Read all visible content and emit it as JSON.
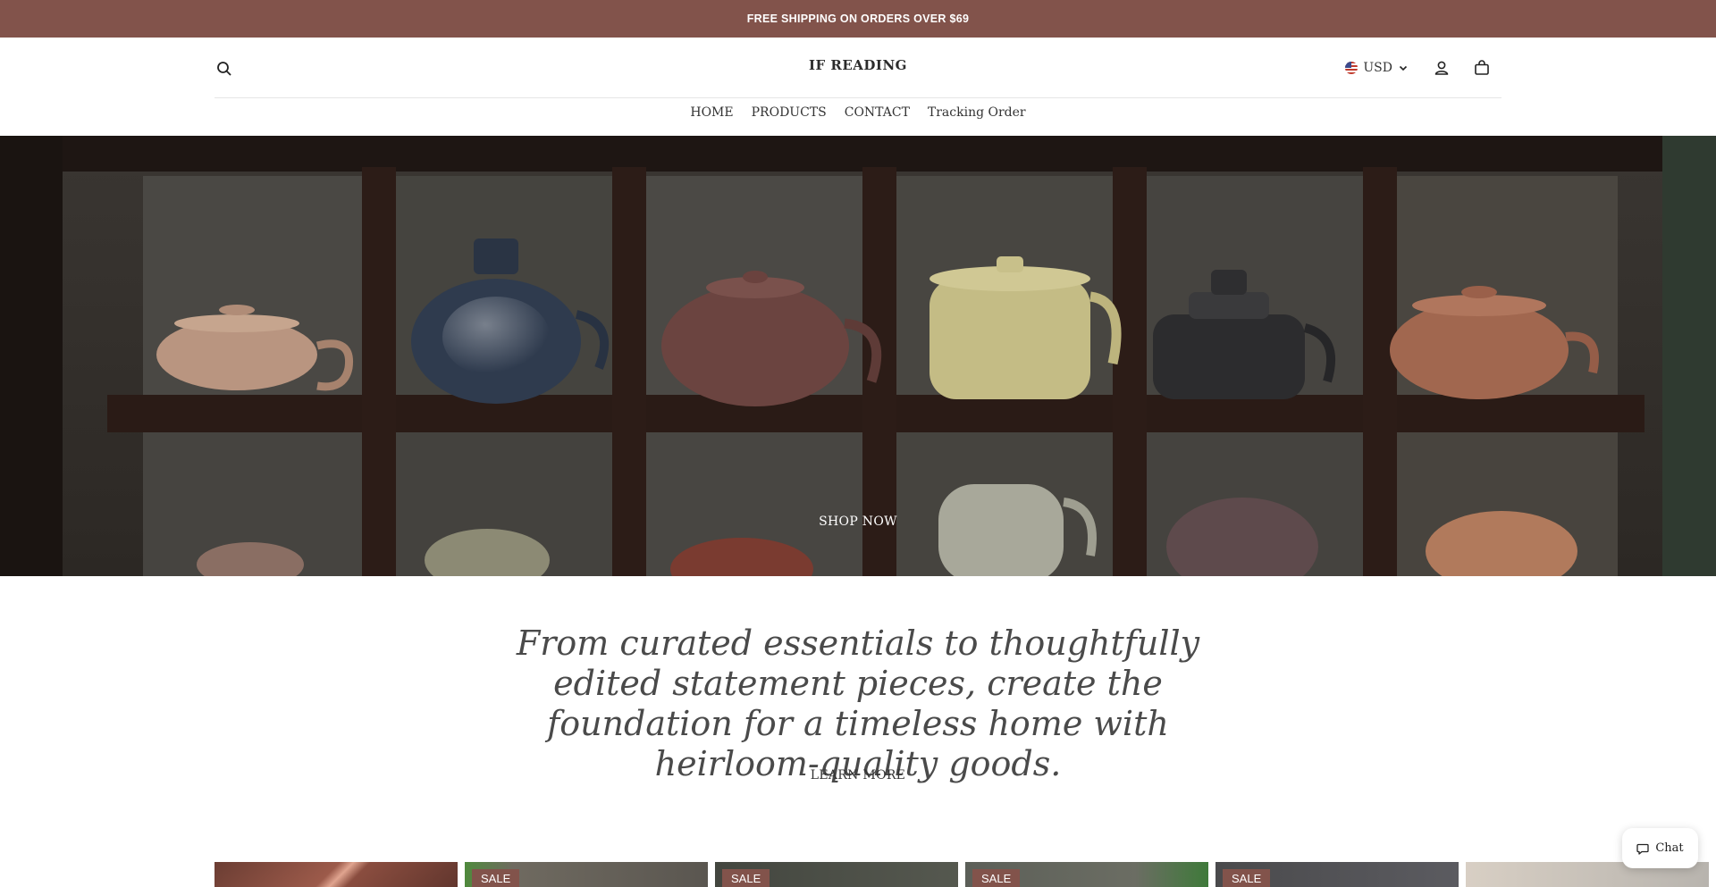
{
  "announcement": {
    "text": "FREE SHIPPING ON ORDERS OVER $69"
  },
  "header": {
    "logo": "IF READING",
    "currency": "USD",
    "icons": {
      "search": "search-icon",
      "account": "user-icon",
      "cart": "shopping-bag-icon",
      "currency_flag": "us-flag-icon",
      "dropdown": "chevron-down-icon"
    }
  },
  "nav": {
    "items": [
      "HOME",
      "PRODUCTS",
      "CONTACT",
      "Tracking Order"
    ]
  },
  "hero": {
    "cta": "SHOP NOW"
  },
  "intro": {
    "tagline": "From curated essentials to thoughtfully edited statement pieces, create the foundation for a timeless home with heirloom-quality goods.",
    "cta": "LEARN MORE"
  },
  "products": {
    "cards": [
      {
        "badge": ""
      },
      {
        "badge": "SALE"
      },
      {
        "badge": "SALE"
      },
      {
        "badge": "SALE"
      },
      {
        "badge": "SALE"
      },
      {
        "badge": ""
      }
    ]
  },
  "chat": {
    "label": "Chat",
    "icon": "chat-bubble-icon"
  },
  "colors": {
    "accent": "#82534b",
    "text": "#3b3b3b",
    "background": "#ffffff"
  }
}
